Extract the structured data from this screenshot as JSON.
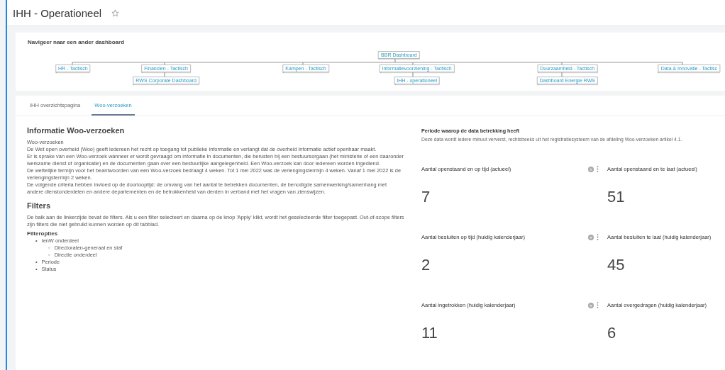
{
  "header": {
    "title": "IHH - Operationeel",
    "favorite": false
  },
  "navigator": {
    "title": "Navigeer naar een ander dashboard",
    "root": {
      "label": "BBR Dashboard",
      "children": [
        {
          "label": "HR - Tactisch"
        },
        {
          "label": "Financien - Tactisch",
          "children": [
            {
              "label": "RWS Corporate Dashboard"
            }
          ]
        },
        {
          "label": "Kampen - Tactisch"
        },
        {
          "label": "Informatievoorziening - Tactisch",
          "children": [
            {
              "label": "IHH - operationeel"
            }
          ]
        },
        {
          "label": "Duurzaamheid - Tactisch",
          "children": [
            {
              "label": "Dashboard Energie RWS"
            }
          ]
        },
        {
          "label": "Data & Innovatie - Tactisc"
        }
      ]
    }
  },
  "tabs": [
    {
      "label": "IHH overzichtspagina",
      "selected": false
    },
    {
      "label": "Woo-verzoeken",
      "selected": true
    }
  ],
  "info": {
    "title": "Informatie Woo-verzoeken",
    "paragraphs": [
      "Woo-verzoeken",
      "De Wet open overheid (Woo) geeft iedereen het recht op toegang tot publieke informatie en verlangt dat de overheid informatie actief openbaar maakt.",
      "Er is sprake van een Woo-verzoek wanneer er wordt gevraagd om informatie in documenten, die berusten bij een bestuursorgaan (het ministerie of een daaronder werkzame dienst of organisatie) en de documenten gaan over een bestuurlijke aangelegenheid. Een Woo-verzoek kan door iedereen worden ingediend.",
      "De wettelijke termijn voor het beantwoorden van een Woo-verzoek bedraagt 4 weken. Tot 1 mei 2022 was de verlengingstermijn 4 weken. Vanaf 1 mei 2022 is de verlengingstermijn 2 weken.",
      "De volgende criteria hebben invloed op de doorlooptijd: de omvang van het aantal te betrekken documenten, de benodigde samenwerking/samenhang met andere dienstonderdelen en andere departementen en de betrokkenheid van derden in verband met het vragen van zienswijzen."
    ],
    "filters_title": "Filters",
    "filters_text": "De balk aan de linkerzijde bevat de filters. Als u een filter selecteert en daarna op de knop 'Apply' klikt, wordt het geselecteerde filter toegepast. Out-of-scope filters zijn filters die niet gebruikt kunnen worden op dit tabblad.",
    "options_title": "Filteropties",
    "options": [
      {
        "marker": "•",
        "label": "IenW onderdeel",
        "children": [
          {
            "marker": "◦",
            "label": "Directoraten-generaal en staf"
          },
          {
            "marker": "◦",
            "label": "Directie onderdeel"
          }
        ]
      },
      {
        "marker": "•",
        "label": "Periode"
      },
      {
        "marker": "•",
        "label": "Status"
      }
    ]
  },
  "period": {
    "title": "Periode waarop de data betrekking heeft",
    "text": "Deze data wordt iedere minuut ververst, rechtstreeks uit het registratiesysteem van de afdeling Woo-verzoeken artikel 4.1."
  },
  "kpis": [
    {
      "title": "Aantal openstaand en op tijd (actueel)",
      "value": "7"
    },
    {
      "title": "Aantal openstaand en te laat (actueel)",
      "value": "51"
    },
    {
      "title": "Aantal besluiten op tijd (huidig kalenderjaar)",
      "value": "2"
    },
    {
      "title": "Aantal besluiten te laat (huidig kalenderjaar)",
      "value": "45"
    },
    {
      "title": "Aantal ingetrokken (huidig kalenderjaar)",
      "value": "11"
    },
    {
      "title": "Aantal overgedragen (huidig kalenderjaar)",
      "value": "6"
    }
  ]
}
